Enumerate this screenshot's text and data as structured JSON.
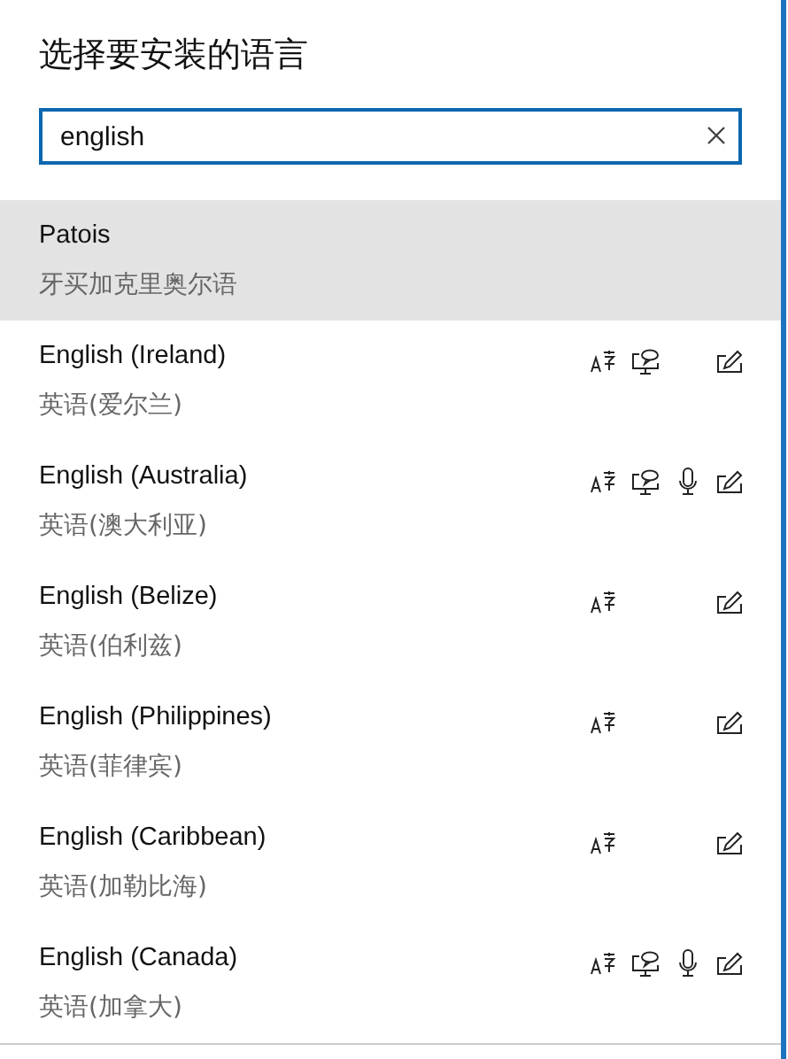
{
  "title": "选择要安装的语言",
  "search": {
    "value": "english"
  },
  "languages": [
    {
      "name": "Patois",
      "native": "牙买加克里奥尔语",
      "selected": true,
      "language_pack": false,
      "display": false,
      "speech": false,
      "handwriting": false
    },
    {
      "name": "English (Ireland)",
      "native": "英语(爱尔兰)",
      "selected": false,
      "language_pack": true,
      "display": true,
      "speech": false,
      "handwriting": true
    },
    {
      "name": "English (Australia)",
      "native": "英语(澳大利亚)",
      "selected": false,
      "language_pack": true,
      "display": true,
      "speech": true,
      "handwriting": true
    },
    {
      "name": "English (Belize)",
      "native": "英语(伯利兹)",
      "selected": false,
      "language_pack": true,
      "display": false,
      "speech": false,
      "handwriting": true
    },
    {
      "name": "English (Philippines)",
      "native": "英语(菲律宾)",
      "selected": false,
      "language_pack": true,
      "display": false,
      "speech": false,
      "handwriting": true
    },
    {
      "name": "English (Caribbean)",
      "native": "英语(加勒比海)",
      "selected": false,
      "language_pack": true,
      "display": false,
      "speech": false,
      "handwriting": true
    },
    {
      "name": "English (Canada)",
      "native": "英语(加拿大)",
      "selected": false,
      "language_pack": true,
      "display": true,
      "speech": true,
      "handwriting": true
    }
  ]
}
